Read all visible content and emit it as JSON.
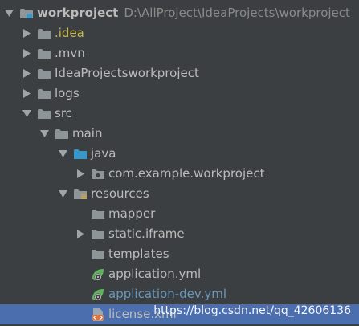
{
  "project_tree": {
    "root": {
      "label": "workproject",
      "path": "D:\\AllProject\\IdeaProjects\\workproject"
    },
    "items": [
      {
        "label": ".idea",
        "icon": "folder-icon",
        "expanded": false
      },
      {
        "label": ".mvn",
        "icon": "folder-icon",
        "expanded": false
      },
      {
        "label": "IdeaProjectsworkproject",
        "icon": "folder-icon",
        "expanded": false
      },
      {
        "label": "logs",
        "icon": "folder-icon",
        "expanded": false
      },
      {
        "label": "src",
        "icon": "folder-icon",
        "expanded": true
      },
      {
        "label": "main",
        "icon": "folder-icon",
        "expanded": true
      },
      {
        "label": "java",
        "icon": "source-folder-icon",
        "expanded": true
      },
      {
        "label": "com.example.workproject",
        "icon": "package-icon",
        "expanded": false
      },
      {
        "label": "resources",
        "icon": "resources-folder-icon",
        "expanded": true
      },
      {
        "label": "mapper",
        "icon": "folder-icon"
      },
      {
        "label": "static.iframe",
        "icon": "folder-icon",
        "expanded": false
      },
      {
        "label": "templates",
        "icon": "folder-icon"
      },
      {
        "label": "application.yml",
        "icon": "spring-config-icon"
      },
      {
        "label": "application-dev.yml",
        "icon": "spring-config-icon"
      },
      {
        "label": "license.xml",
        "icon": "xml-file-icon",
        "selected": true
      }
    ]
  },
  "watermark": "https://blog.csdn.net/qq_42606136",
  "colors": {
    "background": "#3c3f41",
    "text": "#bbbbbb",
    "path_text": "#8a8a8a",
    "idea_text": "#c7b74c",
    "modified_text": "#6897bb",
    "selection": "#4b6eaf",
    "folder": "#8d9599",
    "source_folder": "#3a96c8",
    "spring": "#5fb35c"
  }
}
